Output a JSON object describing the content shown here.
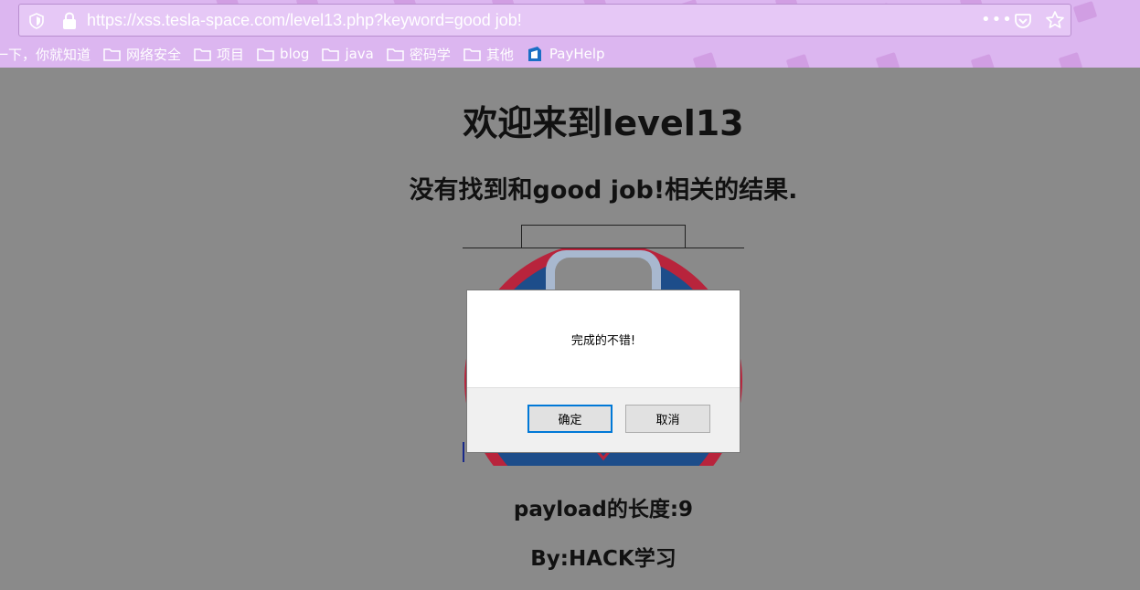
{
  "browser": {
    "url": "https://xss.tesla-space.com/level13.php?keyword=good job!",
    "menu_dots": "•••",
    "bookmarks": [
      {
        "label": "一下，你就知道",
        "icon": "none"
      },
      {
        "label": "网络安全",
        "icon": "folder-icon"
      },
      {
        "label": "项目",
        "icon": "folder-icon"
      },
      {
        "label": "blog",
        "icon": "folder-icon"
      },
      {
        "label": "java",
        "icon": "folder-icon"
      },
      {
        "label": "密码学",
        "icon": "folder-icon"
      },
      {
        "label": "其他",
        "icon": "folder-icon"
      },
      {
        "label": "PayHelp",
        "icon": "payhelp-icon"
      }
    ]
  },
  "page": {
    "title": "欢迎来到level13",
    "result": "没有找到和good job!相关的结果.",
    "payload_length": "payload的长度:9",
    "author": "By:HACK学习"
  },
  "dialog": {
    "message": "完成的不错!",
    "ok_label": "确定",
    "cancel_label": "取消"
  },
  "colors": {
    "chrome": "#dcb6f0",
    "page_bg": "#8a8a8a",
    "dialog_focus": "#0078d7"
  }
}
